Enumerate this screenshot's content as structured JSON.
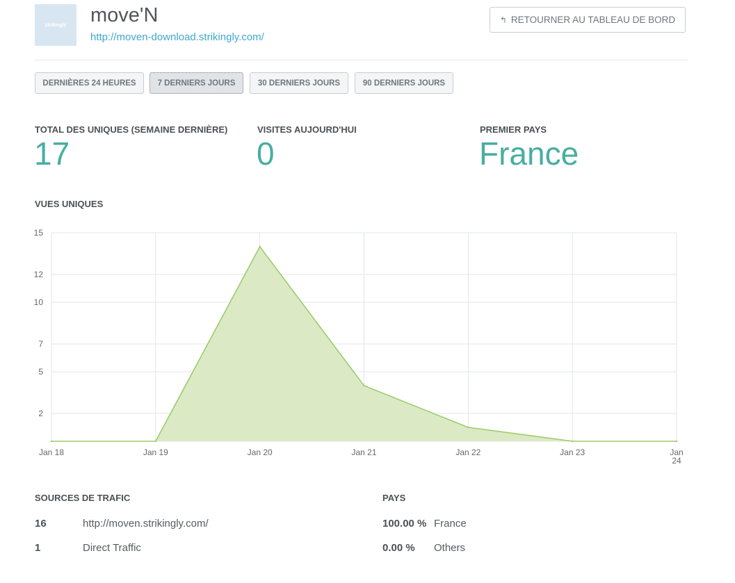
{
  "site": {
    "thumb_text": "strikingly",
    "name": "move'N",
    "url": "http://moven-download.strikingly.com/"
  },
  "back_button": {
    "label": "RETOURNER AU TABLEAU DE BORD",
    "icon": "reply-arrow-icon"
  },
  "ranges": [
    {
      "label": "DERNIÈRES 24 HEURES",
      "active": false
    },
    {
      "label": "7 DERNIERS JOURS",
      "active": true
    },
    {
      "label": "30 DERNIERS JOURS",
      "active": false
    },
    {
      "label": "90 DERNIERS JOURS",
      "active": false
    }
  ],
  "stats": {
    "uniques": {
      "label": "TOTAL DES UNIQUES (SEMAINE DERNIÈRE)",
      "value": "17"
    },
    "today": {
      "label": "VISITES AUJOURD'HUI",
      "value": "0"
    },
    "country": {
      "label": "PREMIER PAYS",
      "value": "France"
    }
  },
  "chart_title": "VUES UNIQUES",
  "chart_data": {
    "type": "area",
    "title": "VUES UNIQUES",
    "x": [
      "Jan 18",
      "Jan 19",
      "Jan 20",
      "Jan 21",
      "Jan 22",
      "Jan 23",
      "Jan 24"
    ],
    "series": [
      {
        "values": [
          0,
          0,
          14,
          4,
          1,
          0,
          0
        ]
      }
    ],
    "yticks": [
      "2",
      "5",
      "7",
      "10",
      "12",
      "15"
    ],
    "ylim": [
      0,
      15
    ],
    "grid": true,
    "colors": {
      "line": "#9ccc6c",
      "fill": "#dbeac5",
      "grid": "#e3e5e7"
    }
  },
  "sources": {
    "title": "SOURCES DE TRAFIC",
    "rows": [
      {
        "count": "16",
        "label": "http://moven.strikingly.com/"
      },
      {
        "count": "1",
        "label": "Direct Traffic"
      }
    ]
  },
  "countries": {
    "title": "PAYS",
    "rows": [
      {
        "pct": "100.00 %",
        "label": "France"
      },
      {
        "pct": "0.00 %",
        "label": "Others"
      }
    ]
  },
  "colors": {
    "accent": "#48aea0",
    "link": "#3fa8ce"
  }
}
